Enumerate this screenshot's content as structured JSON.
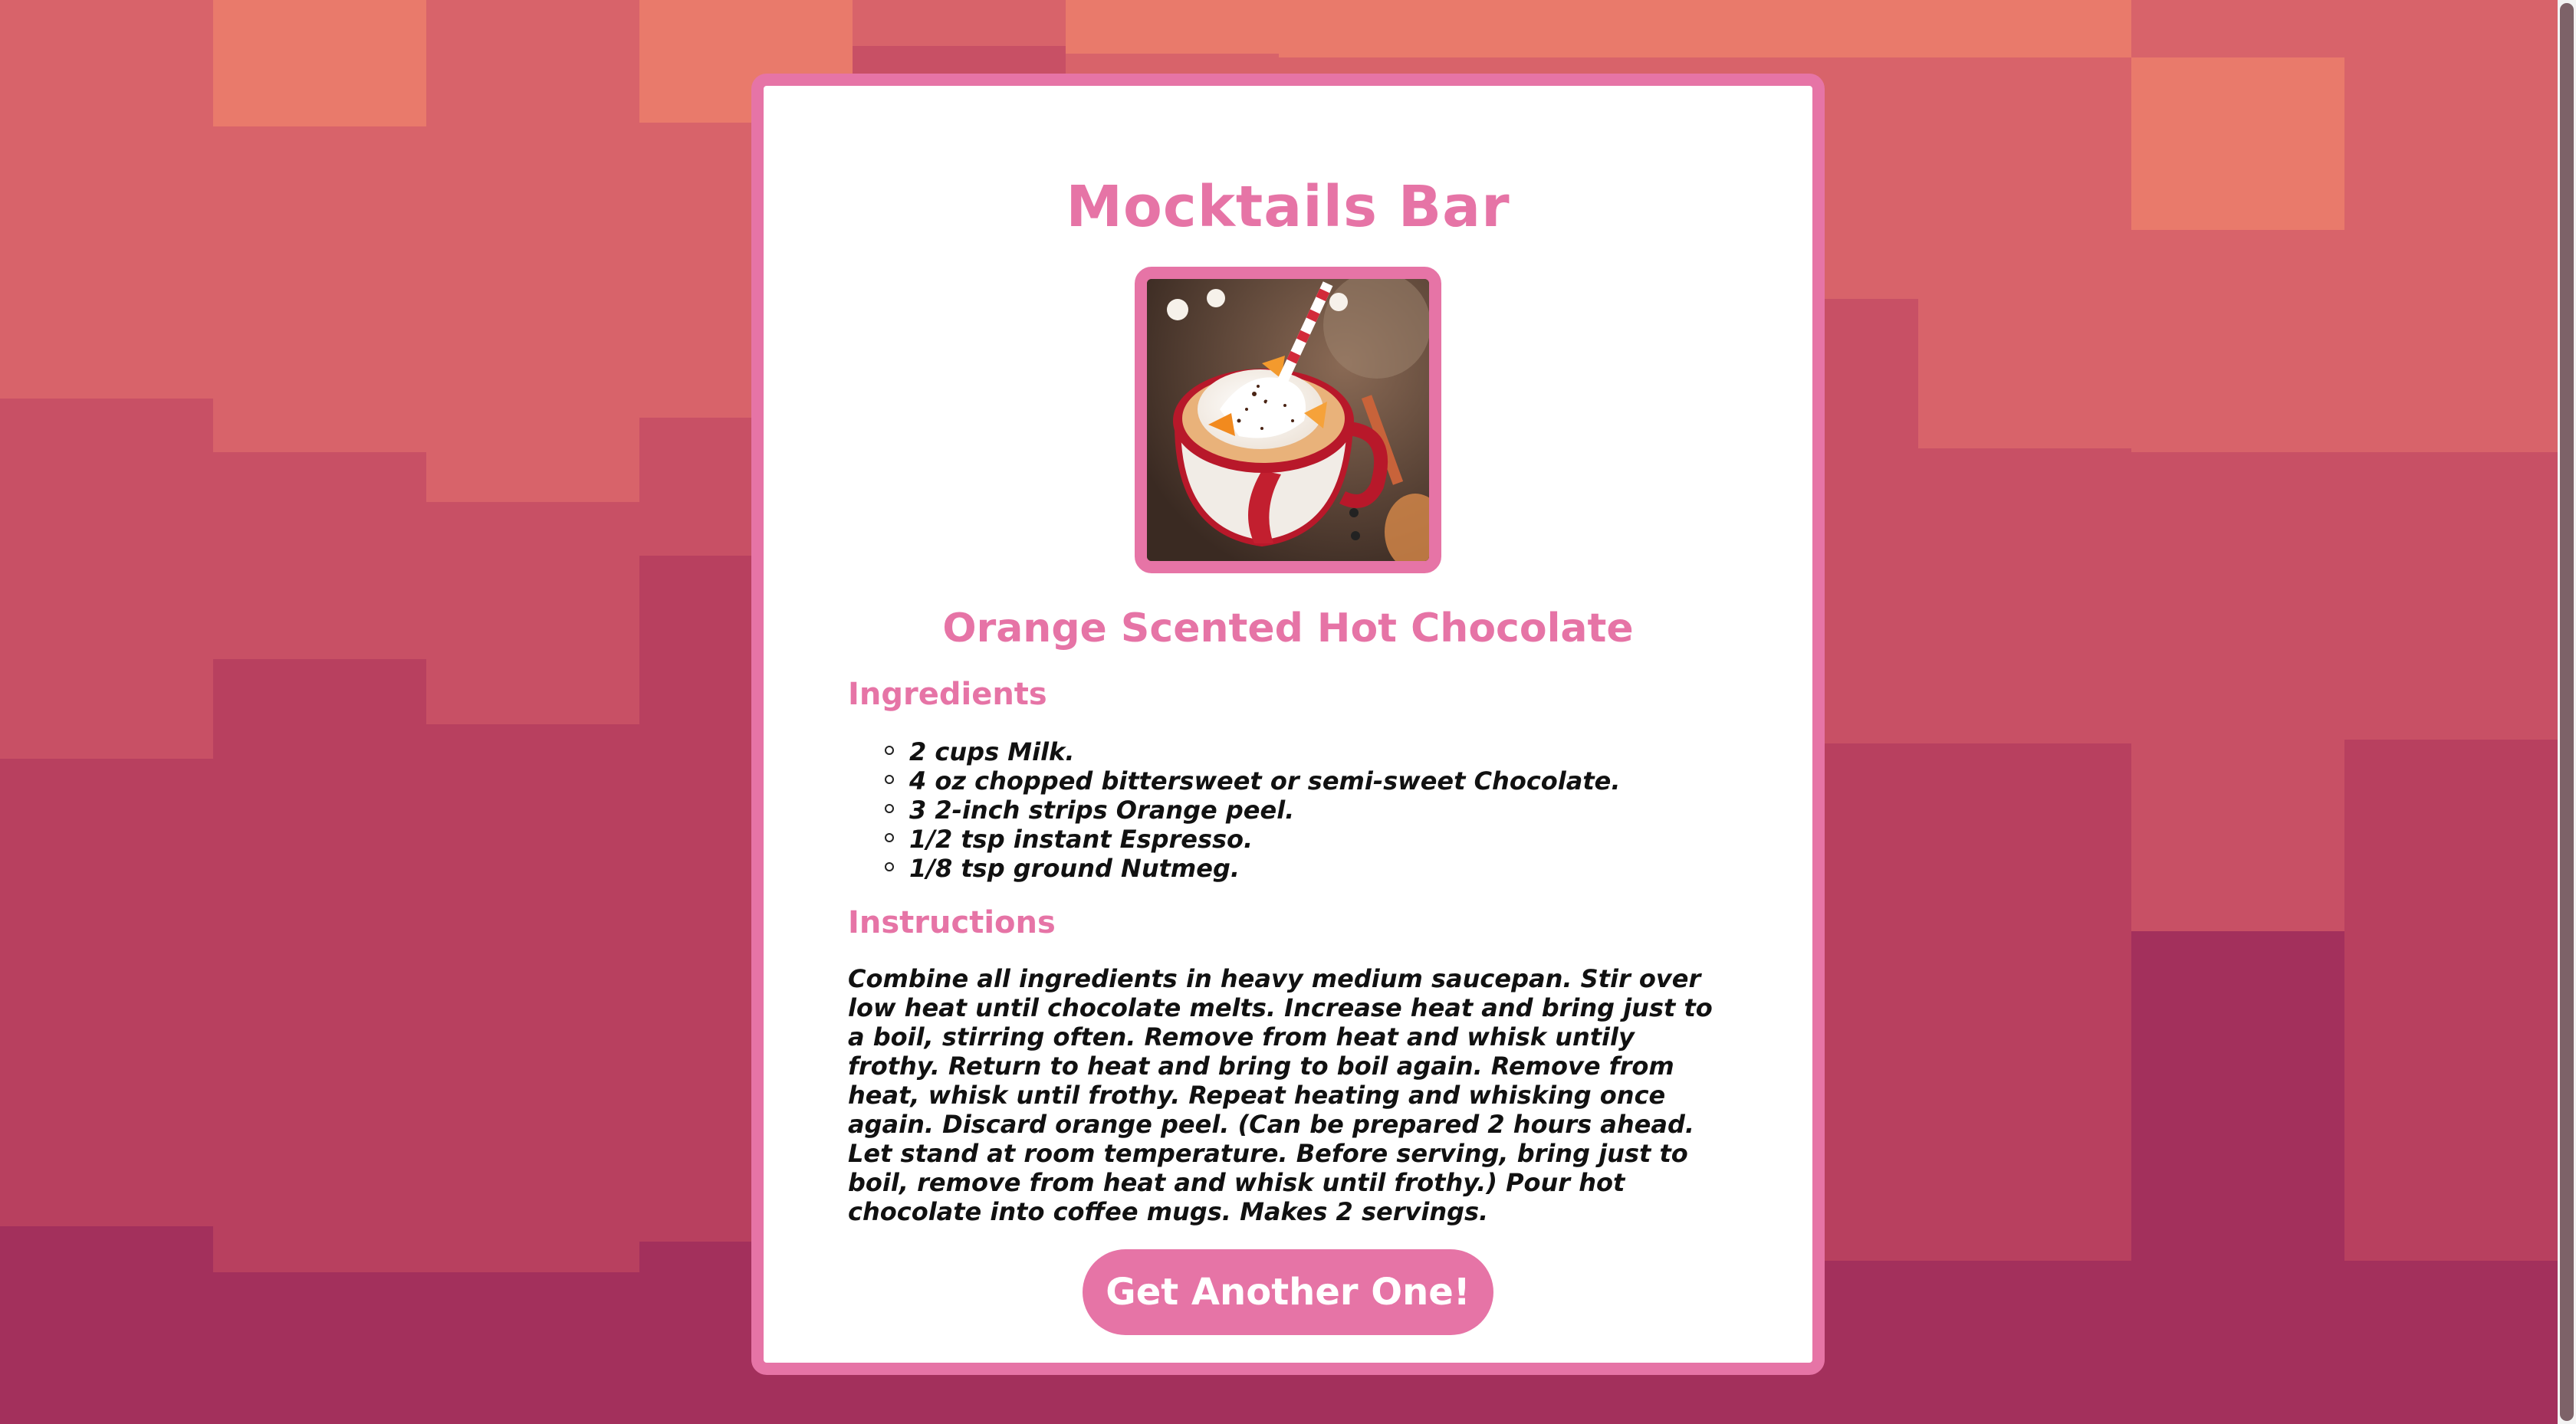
{
  "app": {
    "title": "Mocktails Bar"
  },
  "recipe": {
    "name": "Orange Scented Hot Chocolate",
    "ingredients_heading": "Ingredients",
    "ingredients": [
      "2 cups Milk.",
      "4 oz chopped bittersweet or semi-sweet Chocolate.",
      "3 2-inch strips Orange peel.",
      "1/2 tsp instant Espresso.",
      "1/8 tsp ground Nutmeg."
    ],
    "instructions_heading": "Instructions",
    "instructions": "Combine all ingredients in heavy medium saucepan. Stir over low heat until chocolate melts. Increase heat and bring just to a boil, stirring often. Remove from heat and whisk untily frothy. Return to heat and bring to boil again. Remove from heat, whisk until frothy. Repeat heating and whisking once again. Discard orange peel. (Can be prepared 2 hours ahead. Let stand at room temperature. Before serving, bring just to boil, remove from heat and whisk until frothy.) Pour hot chocolate into coffee mugs. Makes 2 servings."
  },
  "actions": {
    "next_label": "Get Another One!"
  },
  "colors": {
    "accent": "#e674a6",
    "text": "#111111",
    "background_top": "#e97a6b",
    "background_bottom": "#a8325f"
  },
  "icons": {
    "list_bullet": "hollow-circle"
  }
}
